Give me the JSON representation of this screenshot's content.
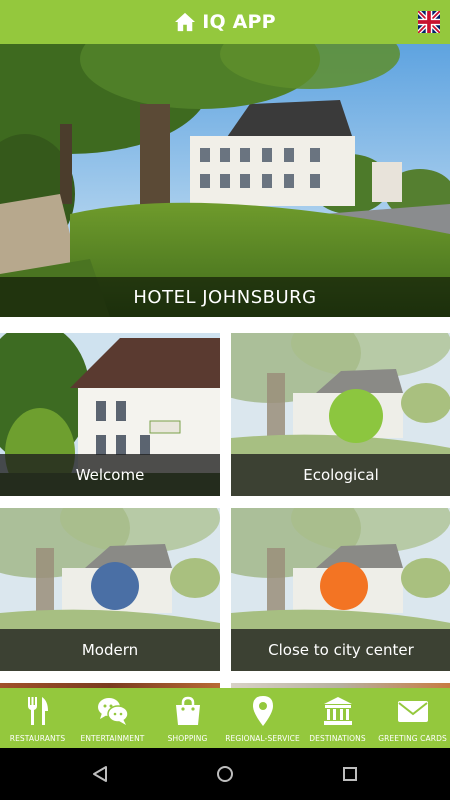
{
  "app": {
    "title": "IQ APP",
    "header_icon": "home-icon",
    "language_flag": "uk-flag-icon"
  },
  "hero": {
    "title": "HOTEL JOHNSBURG"
  },
  "tiles": [
    {
      "label": "Welcome",
      "circle_color": null
    },
    {
      "label": "Ecological",
      "circle_color": "#8cc63f"
    },
    {
      "label": "Modern",
      "circle_color": "#4a6fa5"
    },
    {
      "label": "Close to city center",
      "circle_color": "#f37423"
    }
  ],
  "bottom_nav": {
    "items": [
      {
        "label": "RESTAURANTS",
        "icon": "fork-knife-icon"
      },
      {
        "label": "ENTERTAINMENT",
        "icon": "chat-bubbles-icon"
      },
      {
        "label": "SHOPPING",
        "icon": "shopping-bag-icon"
      },
      {
        "label": "REGIONAL-SERVICE",
        "icon": "map-pin-icon"
      },
      {
        "label": "DESTINATIONS",
        "icon": "landmark-icon"
      },
      {
        "label": "GREETING CARDS",
        "icon": "envelope-icon"
      }
    ]
  },
  "colors": {
    "brand_green": "#94c83d",
    "caption_overlay": "#1e1e1e",
    "system_bar": "#000000"
  }
}
